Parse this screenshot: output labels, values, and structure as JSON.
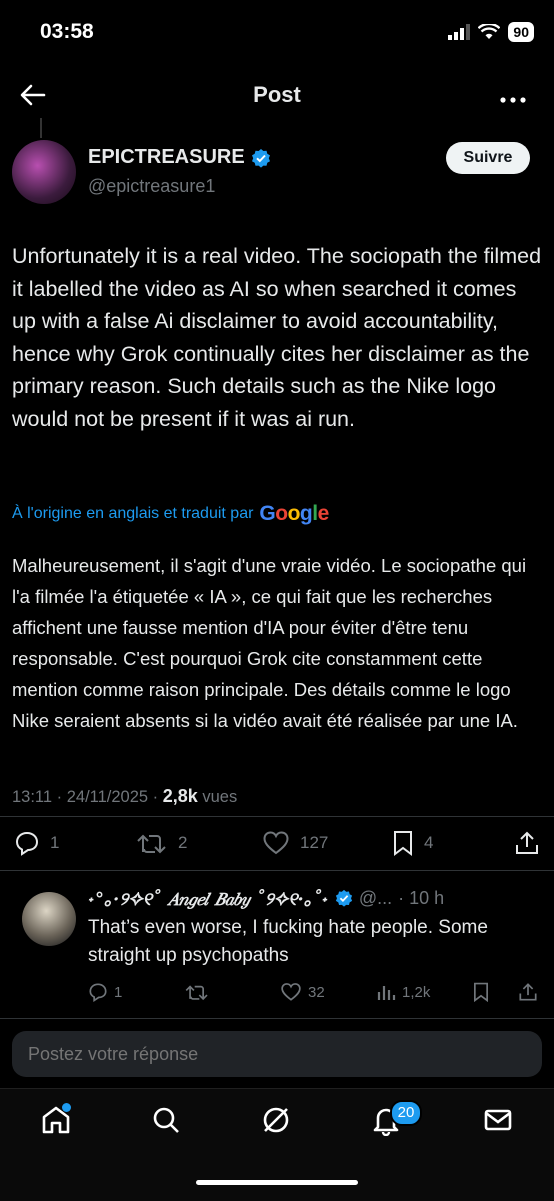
{
  "status_bar": {
    "time": "03:58",
    "battery": "90"
  },
  "header": {
    "title": "Post"
  },
  "post": {
    "author_name": "EPICTREASURE",
    "handle": "@epictreasure1",
    "follow_label": "Suivre",
    "text": "Unfortunately it is a real video. The sociopath the filmed it labelled the video as AI so when searched it comes up with a false Ai disclaimer to avoid accountability, hence why Grok continually cites her disclaimer as the primary reason. Such details such as the Nike logo would not be present if it was ai run.",
    "translated_by": "À l'origine en anglais et traduit par",
    "translation_provider": "Google",
    "translated_text": "Malheureusement, il s'agit d'une vraie vidéo. Le sociopathe qui l'a filmée l'a étiquetée « IA », ce qui fait que les recherches affichent une fausse mention d'IA pour éviter d'être tenu responsable. C'est pourquoi Grok cite constamment cette mention comme raison principale. Des détails comme le logo Nike seraient absents si la vidéo avait été réalisée par une IA.",
    "datetime": "13:11 · 24/11/2025 · ",
    "views_count": "2,8k",
    "views_label": " vues",
    "replies": "1",
    "reposts": "2",
    "likes": "127",
    "bookmarks": "4"
  },
  "reply": {
    "name": "˖°｡·୨✧୧˚ 𝐴𝑛𝑔𝑒𝑙 𝐵𝑎𝑏𝑦 ˚୨✧୧·｡˚˖",
    "handle": "@...",
    "time": "· 10 h",
    "text": "That’s even worse, I fucking hate people. Some straight up psychopaths",
    "replies": "1",
    "likes": "32",
    "views": "1,2k"
  },
  "composer": {
    "placeholder": "Postez votre réponse"
  },
  "tabbar": {
    "notifications_badge": "20"
  },
  "colors": {
    "accent": "#1d9bf0",
    "background": "#000000",
    "muted": "#71767b"
  }
}
